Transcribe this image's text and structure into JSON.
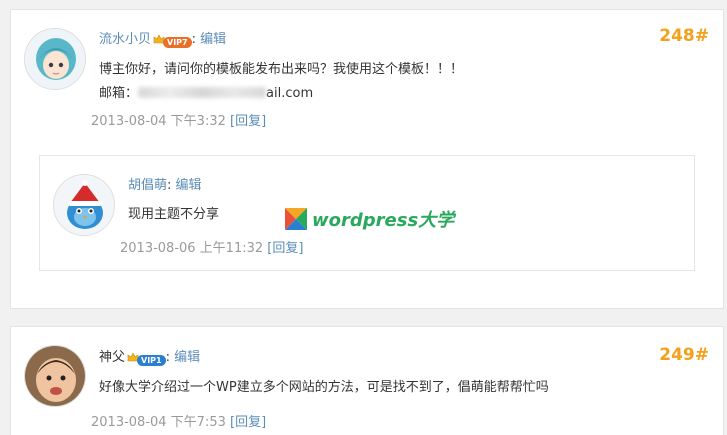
{
  "comments": [
    {
      "author": "流水小贝",
      "vip": "VIP7",
      "colon": ":",
      "edit": "编辑",
      "floor": "248#",
      "line1": "博主你好，请问你的模板能发布出来吗？我使用这个模板！！！",
      "email_label": "邮箱：",
      "email_tail": "ail.com",
      "date": "2013-08-04 下午3:32",
      "reply": "[回复]",
      "child": {
        "author": "胡倡萌",
        "colon": ":",
        "edit": "编辑",
        "text": "现用主题不分享",
        "date": "2013-08-06 上午11:32",
        "reply": "[回复]"
      }
    },
    {
      "author": "神父",
      "vip": "VIP1",
      "colon": ":",
      "edit": "编辑",
      "floor": "249#",
      "text": "好像大学介绍过一个WP建立多个网站的方法，可是找不到了，倡萌能帮帮忙吗",
      "date": "2013-08-04 下午7:53",
      "reply": "[回复]"
    }
  ],
  "watermark": {
    "text": "wordpress大学"
  },
  "colors": {
    "link": "#5b8db8",
    "floor": "#f5a01a",
    "date": "#9a9a9a",
    "watermark": "#2aa85e"
  }
}
